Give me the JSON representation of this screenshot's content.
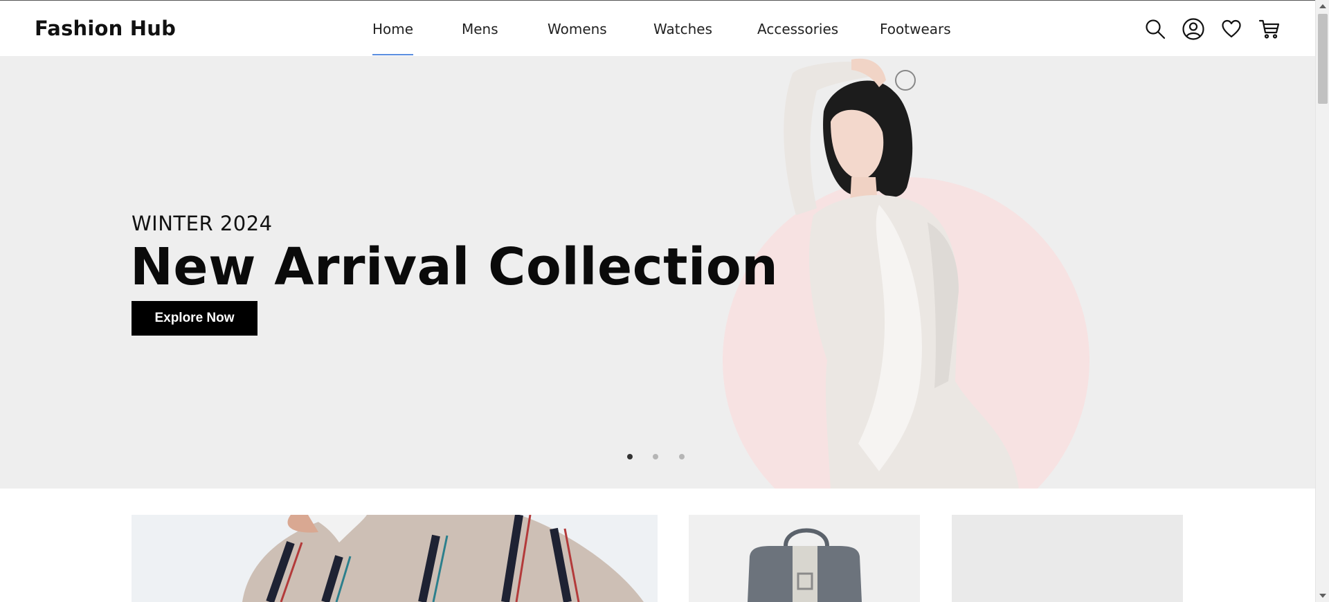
{
  "header": {
    "brand": "Fashion Hub",
    "nav": [
      {
        "label": "Home",
        "active": true
      },
      {
        "label": "Mens",
        "active": false
      },
      {
        "label": "Womens",
        "active": false
      },
      {
        "label": "Watches",
        "active": false
      },
      {
        "label": "Accessories",
        "active": false
      },
      {
        "label": "Footwears",
        "active": false
      }
    ],
    "icons": [
      "search-icon",
      "user-account-icon",
      "heart-icon",
      "cart-icon"
    ]
  },
  "hero": {
    "eyebrow": "WINTER 2024",
    "title": "New Arrival Collection",
    "cta_label": "Explore Now",
    "slides_total": 3,
    "active_slide": 1
  },
  "colors": {
    "hero_bg": "#eeeeee",
    "accent_circle": "#f7e2e2",
    "nav_underline": "#5a8ee0",
    "button_bg": "#000000"
  }
}
